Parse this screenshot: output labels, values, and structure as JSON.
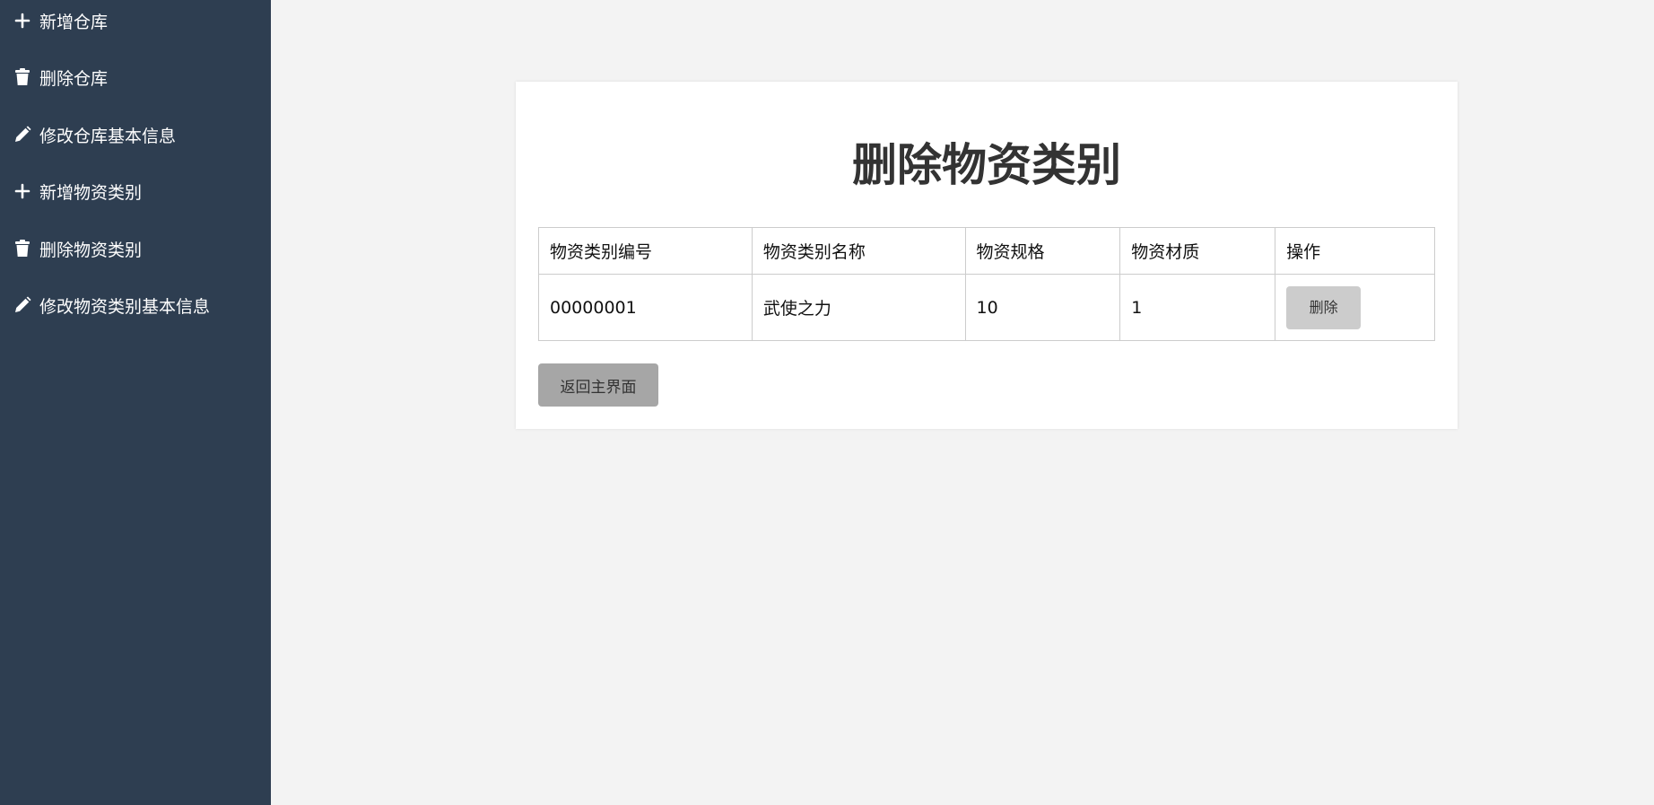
{
  "sidebar": {
    "items": [
      {
        "label": "新增仓库",
        "icon": "plus-icon"
      },
      {
        "label": "删除仓库",
        "icon": "trash-icon"
      },
      {
        "label": "修改仓库基本信息",
        "icon": "pencil-icon"
      },
      {
        "label": "新增物资类别",
        "icon": "plus-icon"
      },
      {
        "label": "删除物资类别",
        "icon": "trash-icon"
      },
      {
        "label": "修改物资类别基本信息",
        "icon": "pencil-icon"
      }
    ]
  },
  "main": {
    "title": "删除物资类别",
    "table": {
      "headers": [
        "物资类别编号",
        "物资类别名称",
        "物资规格",
        "物资材质",
        "操作"
      ],
      "rows": [
        {
          "id": "00000001",
          "name": "武使之力",
          "spec": "10",
          "material": "1",
          "action_label": "删除"
        }
      ]
    },
    "back_button_label": "返回主界面"
  },
  "colors": {
    "sidebar_bg": "#2e3e51",
    "page_bg": "#f3f3f3",
    "delete_button_bg": "#cccccc",
    "back_button_bg": "#a6a6a6"
  }
}
